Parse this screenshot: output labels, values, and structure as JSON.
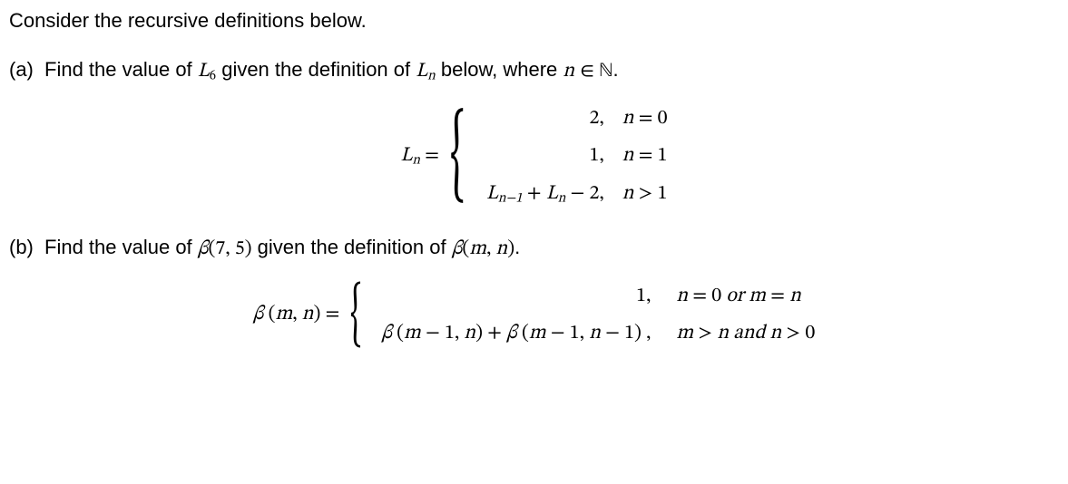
{
  "intro": "Consider the recursive definitions below.",
  "partA": {
    "label": "(a)",
    "text_before": "Find the value of ",
    "L": "L",
    "sub6": "6",
    "text_mid": " given the definition of ",
    "subn": "n",
    "text_after": " below, where ",
    "nvar": "n",
    "in": " ∈ ",
    "Nset": "ℕ",
    "period": "."
  },
  "eqA": {
    "lhs_L": "L",
    "lhs_sub": "n",
    "eq": " = ",
    "case1_val": "2,",
    "case1_cond_n": "n",
    "case1_cond_rest": " = 0",
    "case2_val": "1,",
    "case2_cond_n": "n",
    "case2_cond_rest": " = 1",
    "case3_L1": "L",
    "case3_sub1": "n−1",
    "case3_plus": " + ",
    "case3_L2": "L",
    "case3_sub2": "n",
    "case3_minus2": " − 2,",
    "case3_cond_n": "n",
    "case3_cond_rest": " > 1"
  },
  "partB": {
    "label": "(b)",
    "text_before": "Find the value of ",
    "beta": "β",
    "args75": "(7, 5)",
    "text_mid": " given the definition of ",
    "argsmn": "(m, n)",
    "period": "."
  },
  "eqB": {
    "lhs_beta": "β",
    "lhs_open": " (",
    "lhs_m": "m",
    "lhs_comma": ", ",
    "lhs_n": "n",
    "lhs_close": ") = ",
    "case1_val": "1,",
    "case1_cond_n1": "n",
    "case1_cond_eq0": " = 0 ",
    "case1_cond_or": " or ",
    "case1_cond_m": "m",
    "case1_cond_eq": " = ",
    "case1_cond_n2": "n",
    "case2_b1": "β",
    "case2_open1": " (",
    "case2_m1": "m",
    "case2_minus1a": " − 1, ",
    "case2_n1": "n",
    "case2_close1": ") + ",
    "case2_b2": "β",
    "case2_open2": " (",
    "case2_m2": "m",
    "case2_minus1b": " − 1, ",
    "case2_n2": "n",
    "case2_minus1c": " − 1) ,",
    "case2_cond_m": "m",
    "case2_cond_gt": " > ",
    "case2_cond_n1": "n",
    "case2_cond_and": "  and  ",
    "case2_cond_n2": "n",
    "case2_cond_gt0": " > 0"
  }
}
